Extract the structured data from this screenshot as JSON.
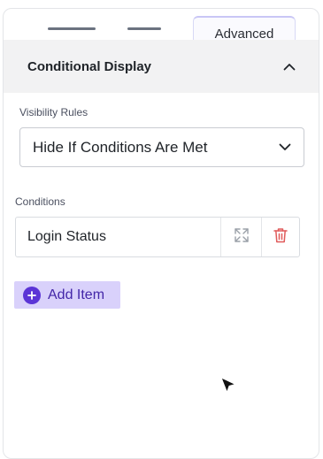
{
  "tabs": {
    "active_label": "Advanced"
  },
  "section": {
    "title": "Conditional Display"
  },
  "visibility": {
    "label": "Visibility Rules",
    "selected": "Hide If Conditions Are Met"
  },
  "conditions": {
    "label": "Conditions",
    "items": [
      {
        "name": "Login Status"
      }
    ]
  },
  "add_item": {
    "label": "Add Item"
  },
  "icons": {
    "collapse": "chevron-up-icon",
    "dropdown": "chevron-down-icon",
    "expand": "expand-icon",
    "delete": "trash-icon",
    "add": "plus-circle-icon",
    "cursor": "mouse-pointer-icon"
  },
  "colors": {
    "accent": "#5b34d6",
    "accent_light": "#d9d1fb",
    "danger": "#e05a5a",
    "header_bg": "#f2f2f3"
  }
}
